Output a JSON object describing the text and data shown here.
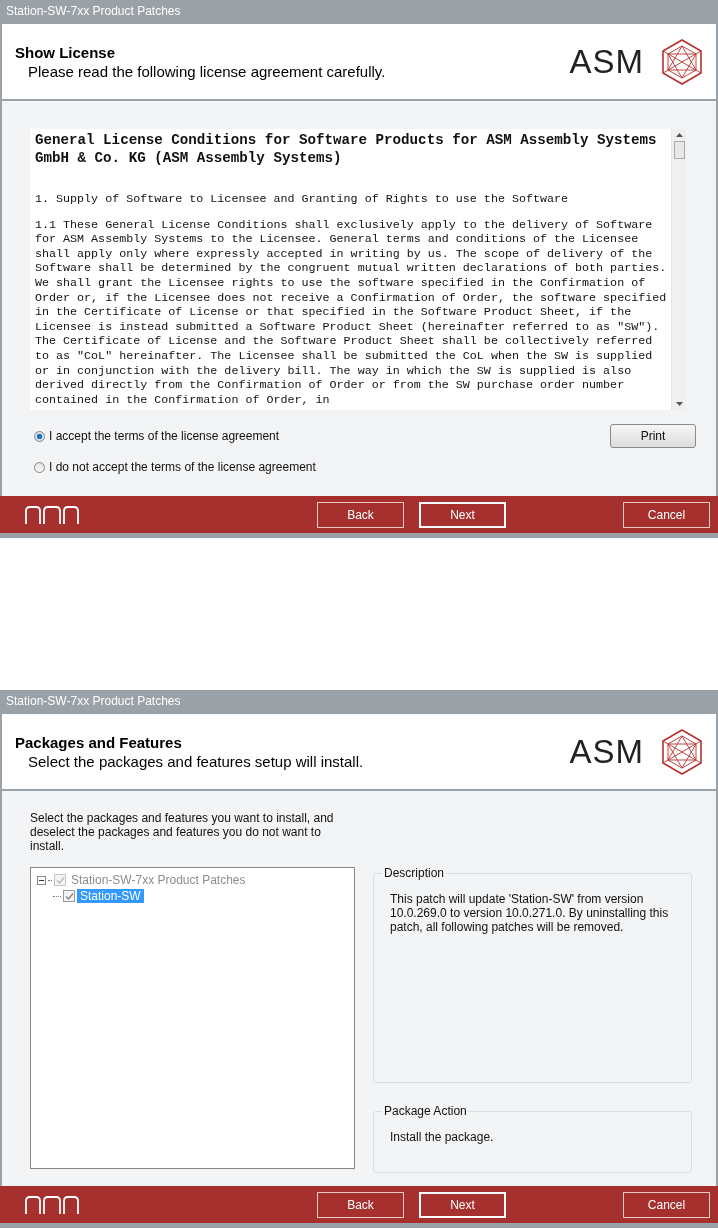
{
  "dialogs": [
    {
      "kind": "license",
      "window_title": "Station-SW-7xx Product Patches",
      "header": {
        "title": "Show License",
        "subtitle": "Please read the following license agreement carefully.",
        "logo_text": "ASM"
      },
      "license": {
        "heading": "General License Conditions for Software Products for ASM Assembly Systems GmbH & Co. KG (ASM Assembly Systems)",
        "paragraphs": [
          "1. Supply of Software to Licensee and Granting of Rights to use the Software",
          "1.1 These General License Conditions shall exclusively apply to the delivery of Software for ASM Assembly Systems to the Licensee. General terms and conditions of the Licensee shall apply only where expressly accepted in writing by us. The scope of delivery of the Software shall be determined by the congruent mutual written declarations of both parties. We shall grant the Licensee rights to use the software specified in the Confirmation of Order or, if the Licensee does not receive a Confirmation of Order, the software specified in the Certificate of License or that specified in the Software Product Sheet, if the Licensee is instead submitted a Software Product Sheet (hereinafter referred to as \"SW\"). The Certificate of License and the Software Product Sheet shall be collectively referred to as \"CoL\" hereinafter. The Licensee shall be submitted the CoL when the SW is supplied or in conjunction with the delivery bill. The way in which the SW is supplied is also derived directly from the Confirmation of Order or from the SW purchase order number contained in the Confirmation of Order, in"
        ]
      },
      "options": [
        {
          "label": "I accept the terms of the license agreement",
          "selected": true
        },
        {
          "label": "I do not accept the terms of the license agreement",
          "selected": false
        }
      ],
      "print_button": "Print",
      "footer_buttons": [
        {
          "label": "Back",
          "default": false
        },
        {
          "label": "Next",
          "default": true
        },
        {
          "label": "Cancel",
          "default": false
        }
      ]
    },
    {
      "kind": "packages",
      "window_title": "Station-SW-7xx Product Patches",
      "header": {
        "title": "Packages and Features",
        "subtitle": "Select the packages and features setup will install.",
        "logo_text": "ASM"
      },
      "instructions": "Select the packages and features you want to install, and deselect the packages and features you do not want to install.",
      "tree": [
        {
          "label": "Station-SW-7xx Product Patches",
          "checked": true,
          "disabled": true,
          "expanded": true,
          "selected": false,
          "children": [
            {
              "label": "Station-SW",
              "checked": true,
              "disabled": false,
              "selected": true
            }
          ]
        }
      ],
      "groups": [
        {
          "title": "Description",
          "text": "This patch will update 'Station-SW' from version 10.0.269.0 to version 10.0.271.0. By uninstalling this patch, all following patches will be removed."
        },
        {
          "title": "Package Action",
          "text": "Install the package."
        }
      ],
      "footer_buttons": [
        {
          "label": "Back",
          "default": false
        },
        {
          "label": "Next",
          "default": true
        },
        {
          "label": "Cancel",
          "default": false
        }
      ]
    }
  ]
}
